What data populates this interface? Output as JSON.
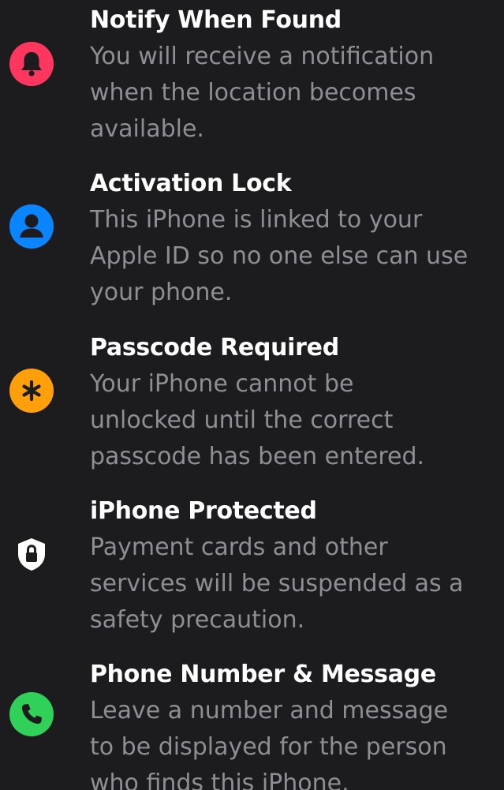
{
  "features": [
    {
      "title": "Notify When Found",
      "lines": [
        "You will receive a notification",
        "when the location becomes",
        "available."
      ],
      "icon": "bell-icon",
      "color": "#ff375f"
    },
    {
      "title": "Activation Lock",
      "lines": [
        "This iPhone is linked to your",
        "Apple ID so no one else can use",
        "your phone."
      ],
      "icon": "person-icon",
      "color": "#0a84ff"
    },
    {
      "title": "Passcode Required",
      "lines": [
        "Your iPhone cannot be",
        "unlocked until the correct",
        "passcode has been entered."
      ],
      "icon": "asterisk-icon",
      "color": "#ff9f0a"
    },
    {
      "title": "iPhone Protected",
      "lines": [
        "Payment cards and other",
        "services will be suspended as a",
        "safety precaution."
      ],
      "icon": "shield-lock-icon",
      "color": "#ffffff"
    },
    {
      "title": "Phone Number & Message",
      "lines": [
        "Leave a number and message",
        "to be displayed for the person",
        "who finds this iPhone."
      ],
      "icon": "phone-icon",
      "color": "#30d158"
    }
  ]
}
